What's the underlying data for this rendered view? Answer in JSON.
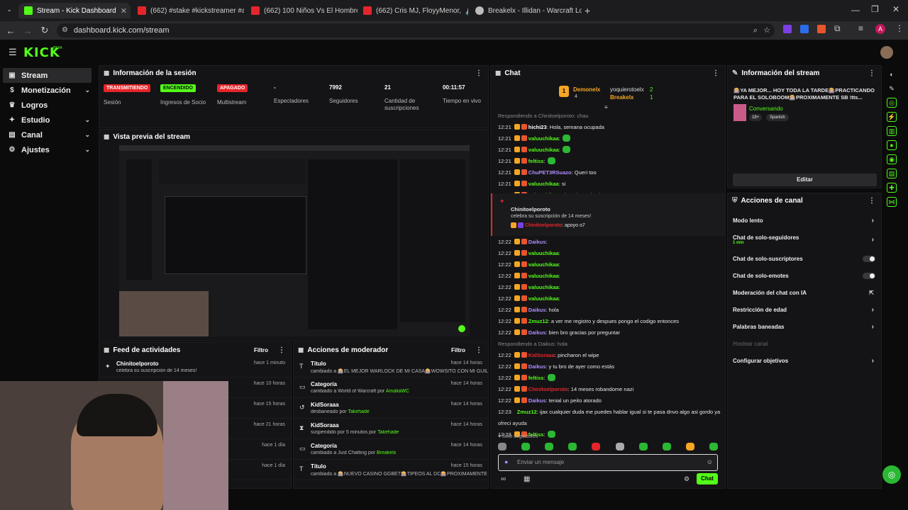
{
  "browser": {
    "tabs": [
      {
        "title": "Stream - Kick Dashboard",
        "fav": "#53fc18"
      },
      {
        "title": "(662) #stake #kickstreamer #an",
        "fav": "#e5252a"
      },
      {
        "title": "(662) 100 Niños Vs El Hombre M",
        "fav": "#e5252a"
      },
      {
        "title": "(662) Cris MJ, FloyyMenor,",
        "fav": "#e5252a"
      },
      {
        "title": "Breakelx - Illidan - Warcraft Log",
        "fav": "#bbbbbb"
      }
    ],
    "url": "dashboard.kick.com/stream",
    "avatar_letter": "A"
  },
  "header": {
    "logo": "KICK",
    "beta": "BETA"
  },
  "sidebar": {
    "items": [
      {
        "label": "Stream",
        "icon": "video-icon",
        "glyph": "▣",
        "chev": ""
      },
      {
        "label": "Monetización",
        "icon": "money-icon",
        "glyph": "$",
        "chev": "⌄"
      },
      {
        "label": "Logros",
        "icon": "trophy-icon",
        "glyph": "♛",
        "chev": ""
      },
      {
        "label": "Estudio",
        "icon": "studio-icon",
        "glyph": "✦",
        "chev": "⌄"
      },
      {
        "label": "Canal",
        "icon": "channel-icon",
        "glyph": "▤",
        "chev": "⌄"
      },
      {
        "label": "Ajustes",
        "icon": "gear-icon",
        "glyph": "⚙",
        "chev": "⌄"
      }
    ]
  },
  "session": {
    "title": "Información de la sesión",
    "stats": [
      {
        "value": "TRANSMITIENDO",
        "label": "Sesión",
        "kind": "badge",
        "bg": "#e5252a",
        "fg": "#ffffff"
      },
      {
        "value": "ENCENDIDO",
        "label": "Ingresos de Socio",
        "kind": "badge",
        "bg": "#53fc18",
        "fg": "#0b0b0c"
      },
      {
        "value": "APAGADO",
        "label": "Multistream",
        "kind": "badge",
        "bg": "#e5252a",
        "fg": "#ffffff"
      },
      {
        "value": "-",
        "label": "Espectadores",
        "kind": "text"
      },
      {
        "value": "7992",
        "label": "Seguidores",
        "kind": "text"
      },
      {
        "value": "21",
        "label": "Cantidad de suscripciones",
        "kind": "text"
      },
      {
        "value": "00:11:57",
        "label": "Tiempo en vivo",
        "kind": "text"
      }
    ]
  },
  "preview": {
    "title": "Vista previa del stream"
  },
  "feed": {
    "title": "Feed de actividades",
    "filter": "Filtro",
    "rows": [
      {
        "name": "Chinitoelporoto",
        "text": "celebra su suscripción de 14 meses!",
        "time": "hace 1 minuto"
      },
      {
        "name": "",
        "text": "",
        "time": "hace 10 horas"
      },
      {
        "name": "",
        "text": "",
        "time": "hace 15 horas"
      },
      {
        "name": "",
        "text": "",
        "time": "hace 21 horas"
      },
      {
        "name": "",
        "text": "",
        "time": "hace 1 día"
      },
      {
        "name": "",
        "text": "",
        "time": "hace 1 día"
      }
    ]
  },
  "modactions": {
    "title": "Acciones de moderador",
    "filter": "Filtro",
    "rows": [
      {
        "icon": "text-icon",
        "glyph": "T",
        "title": "Título",
        "text": "cambiado a 🎰EL MEJOR WARLOCK DE MI CASA🎰WOWSITO CON MI GUILD 🎰PROXIMAMENTE SB !tts !micasino !dc",
        "by": "AmaliaWC",
        "time": "hace 14 horas"
      },
      {
        "icon": "category-icon",
        "glyph": "▭",
        "title": "Categoría",
        "text": "cambiado a World of Warcraft",
        "by": "AmaliaWC",
        "time": "hace 14 horas"
      },
      {
        "icon": "unban-icon",
        "glyph": "↺",
        "title": "KidSoraaa",
        "text": "desbaneado",
        "by": "Takehade",
        "time": "hace 14 horas"
      },
      {
        "icon": "hourglass-icon",
        "glyph": "⧗",
        "title": "KidSoraaa",
        "text": "suspendido por 5 minutos",
        "by": "Takehade",
        "time": "hace 14 horas"
      },
      {
        "icon": "category-icon",
        "glyph": "▭",
        "title": "Categoría",
        "text": "cambiado a Just Chatting",
        "by": "Breakelx",
        "time": "hace 14 horas"
      },
      {
        "icon": "text-icon",
        "glyph": "T",
        "title": "Título",
        "text": "cambiado a 🎰NUEVO CASINO GGBET🎰TIPEOS AL DC🎰PROXIMAMENTE",
        "by": "",
        "time": "hace 15 horas"
      }
    ]
  },
  "chat": {
    "title": "Chat",
    "leaders": [
      {
        "name": "Demonelx",
        "count": "4",
        "color": "#f5a623"
      },
      {
        "name": "yoquierotoelx",
        "count": "2",
        "color": "#dddddd"
      },
      {
        "name": "Breakelx",
        "count": "1",
        "color": "#f5a623"
      }
    ],
    "lines": [
      {
        "time": "",
        "user": "Respondiendo a Chinitoelporoto: chau",
        "ucolor": "#888888",
        "msg": "",
        "emo": 0
      },
      {
        "time": "12:21",
        "user": "hichi23",
        "ucolor": "#ffffff",
        "msg": ": Hola, semana ocupada",
        "emo": 0
      },
      {
        "time": "12:21",
        "user": "valuuchikaa",
        "ucolor": "#53fc18",
        "msg": ":",
        "emo": 1
      },
      {
        "time": "12:21",
        "user": "valuuchikaa",
        "ucolor": "#53fc18",
        "msg": ":",
        "emo": 1
      },
      {
        "time": "12:21",
        "user": "feltiss",
        "ucolor": "#53fc18",
        "msg": ":",
        "emo": 1
      },
      {
        "time": "12:21",
        "user": "ChuPET3RSuazo",
        "ucolor": "#b18cff",
        "msg": ": Queri too",
        "emo": 0
      },
      {
        "time": "12:21",
        "user": "valuuchikaa",
        "ucolor": "#53fc18",
        "msg": ": si",
        "emo": 0
      },
      {
        "time": "12:21",
        "user": "valuuchikaa",
        "ucolor": "#53fc18",
        "msg": ": el 13 de noviembre",
        "emo": 0
      }
    ],
    "sub": {
      "name": "Chinitoelporoto",
      "text": "celebra su suscripción de 14 meses!",
      "user": "Chinitoelporoto",
      "msg": "apoyo o7"
    },
    "lines2": [
      {
        "time": "12:22",
        "user": "Daikus",
        "ucolor": "#b18cff",
        "msg": ":",
        "emo": 0
      },
      {
        "time": "12:22",
        "user": "valuuchikaa",
        "ucolor": "#53fc18",
        "msg": ":",
        "emo": 0
      },
      {
        "time": "12:22",
        "user": "valuuchikaa",
        "ucolor": "#53fc18",
        "msg": ":",
        "emo": 0
      },
      {
        "time": "12:22",
        "user": "valuuchikaa",
        "ucolor": "#53fc18",
        "msg": ":",
        "emo": 0
      },
      {
        "time": "12:22",
        "user": "valuuchikaa",
        "ucolor": "#53fc18",
        "msg": ":",
        "emo": 0
      },
      {
        "time": "12:22",
        "user": "valuuchikaa",
        "ucolor": "#53fc18",
        "msg": ":",
        "emo": 0
      },
      {
        "time": "12:22",
        "user": "Daikus",
        "ucolor": "#b18cff",
        "msg": ": hola",
        "emo": 0
      },
      {
        "time": "12:22",
        "user": "Zmuz12",
        "ucolor": "#53fc18",
        "msg": ": a ver me registro y despues pongo el codigo entonces",
        "emo": 0
      },
      {
        "time": "12:22",
        "user": "Daikus",
        "ucolor": "#b18cff",
        "msg": ": bien bro gracias por preguntar",
        "emo": 0
      },
      {
        "time": "",
        "user": "Respondiendo a Daikus: hola",
        "ucolor": "#888888",
        "msg": "",
        "emo": 0
      },
      {
        "time": "12:22",
        "user": "KidSoraaa",
        "ucolor": "#e5252a",
        "msg": ": pincharon el wipe",
        "emo": 0
      },
      {
        "time": "12:22",
        "user": "Daikus",
        "ucolor": "#b18cff",
        "msg": ": y tu bro de ayer como estás",
        "emo": 0
      },
      {
        "time": "12:22",
        "user": "feltiss",
        "ucolor": "#53fc18",
        "msg": ":",
        "emo": 1
      },
      {
        "time": "12:22",
        "user": "Chinitoelporoto",
        "ucolor": "#e5252a",
        "msg": ": 14 meses robandome nazi",
        "emo": 0
      },
      {
        "time": "12:22",
        "user": "Daikus",
        "ucolor": "#b18cff",
        "msg": ": tenial un peito atorado",
        "emo": 0
      },
      {
        "time": "12:23",
        "user": "Zmuz12",
        "ucolor": "#53fc18",
        "msg": ": ijax cualquier duda me puedes hablar igual si te pasa dnvo algo asi gordo ya te",
        "emo": 0
      },
      {
        "time": "",
        "user": "ofreci ayuda",
        "ucolor": "#dddddd",
        "msg": "",
        "emo": 0
      },
      {
        "time": "12:23",
        "user": "feltiss",
        "ucolor": "#53fc18",
        "msg": ":",
        "emo": 1
      }
    ],
    "followers_only": "Solo seguidores",
    "placeholder": "Enviar un mensaje",
    "send": "Chat"
  },
  "streaminfo": {
    "title": "Información del stream",
    "stream_title": "🎰YA MEJOR... HOY TODA LA TARDE🎰PRACTICANDO PARA EL SOLOBOOM🎰PROXIMAMENTE SB !tts...",
    "category": "Conversando",
    "tags": [
      "18+",
      "Spanish"
    ],
    "edit": "Editar"
  },
  "channel": {
    "title": "Acciones de canal",
    "items": [
      {
        "label": "Modo lento",
        "sub": "",
        "ctrl": "chevron"
      },
      {
        "label": "Chat de solo-seguidores",
        "sub": "1 min",
        "ctrl": "chevron"
      },
      {
        "label": "Chat de solo-suscriptores",
        "sub": "",
        "ctrl": "toggle"
      },
      {
        "label": "Chat de solo-emotes",
        "sub": "",
        "ctrl": "toggle"
      },
      {
        "label": "Moderación del chat con IA",
        "sub": "",
        "ctrl": "external"
      },
      {
        "label": "Restricción de edad",
        "sub": "",
        "ctrl": "chevron"
      },
      {
        "label": "Palabras baneadas",
        "sub": "",
        "ctrl": "chevron"
      },
      {
        "label": "Hostear canal",
        "sub": "",
        "ctrl": "disabled"
      },
      {
        "label": "Configurar objetivos",
        "sub": "",
        "ctrl": "chevron"
      }
    ]
  }
}
